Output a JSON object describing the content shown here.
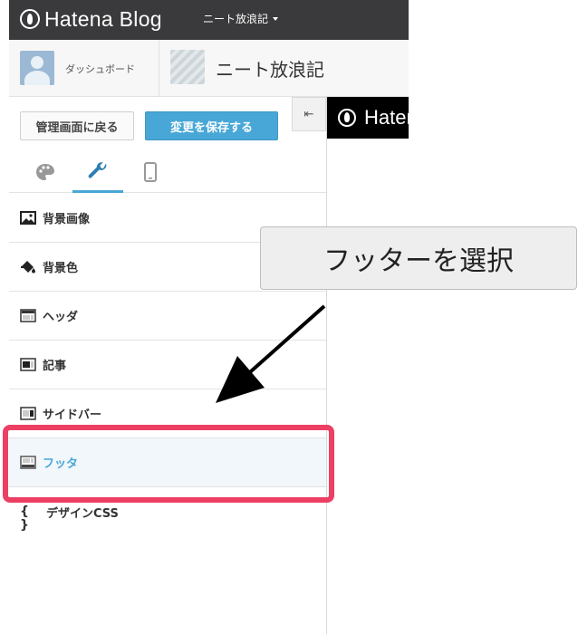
{
  "topbar": {
    "logo_text": "Hatena Blog",
    "blog_selector": "ニート放浪記"
  },
  "subbar": {
    "dashboard_label": "ダッシュボード",
    "blog_title": "ニート放浪記"
  },
  "panel": {
    "back_button": "管理画面に戻る",
    "save_button": "変更を保存する",
    "collapse_glyph": "⇤",
    "tabs": [
      {
        "icon": "palette-icon",
        "active": false
      },
      {
        "icon": "wrench-icon",
        "active": true
      },
      {
        "icon": "smartphone-icon",
        "active": false
      }
    ],
    "menu": [
      {
        "label": "背景画像",
        "icon": "image-icon"
      },
      {
        "label": "背景色",
        "icon": "paint-bucket-icon"
      },
      {
        "label": "ヘッダ",
        "icon": "layout-header-icon"
      },
      {
        "label": "記事",
        "icon": "layout-article-icon"
      },
      {
        "label": "サイドバー",
        "icon": "layout-sidebar-icon"
      },
      {
        "label": "フッタ",
        "icon": "layout-footer-icon",
        "selected": true
      },
      {
        "label": "デザインCSS",
        "icon": "braces-icon",
        "glyph": "{ }"
      }
    ]
  },
  "preview": {
    "logo_text": "Hatena"
  },
  "annotation": {
    "callout_text": "フッターを選択",
    "highlight_color": "#ec3f63"
  },
  "colors": {
    "accent": "#48a7d6",
    "topbar": "#3a3a3c"
  }
}
